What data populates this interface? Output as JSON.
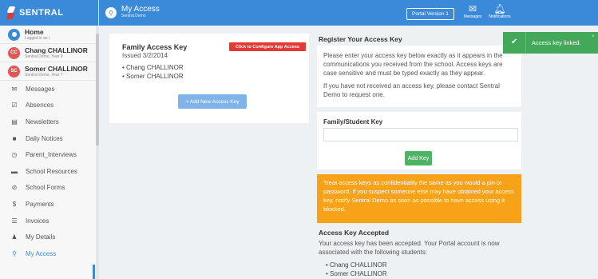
{
  "app": {
    "brand": "SENTRAL",
    "page_title": "My Access",
    "page_subtitle": "Sentral Demo"
  },
  "topbar": {
    "portal_version": "Portal Version 1",
    "messages_label": "Messages",
    "notifications_label": "Notifications"
  },
  "sidebar": {
    "profiles": [
      {
        "name": "Home",
        "sub": "Logged in as i",
        "initials": ""
      },
      {
        "name": "Chang CHALLINOR",
        "sub": "Sentral Demo, Year 9",
        "initials": "CC"
      },
      {
        "name": "Somer CHALLINOR",
        "sub": "Sentral Demo, Year 7",
        "initials": "SC"
      }
    ],
    "items": [
      {
        "label": "Messages",
        "icon": "envelope-icon",
        "glyph": "✉"
      },
      {
        "label": "Absences",
        "icon": "check-icon",
        "glyph": "☑"
      },
      {
        "label": "Newsletters",
        "icon": "newspaper-icon",
        "glyph": "▤"
      },
      {
        "label": "Daily Notices",
        "icon": "notice-icon",
        "glyph": "■"
      },
      {
        "label": "Parent_Interviews",
        "icon": "clock-icon",
        "glyph": "◷"
      },
      {
        "label": "School Resources",
        "icon": "folder-icon",
        "glyph": "▬"
      },
      {
        "label": "School Forms",
        "icon": "forms-icon",
        "glyph": "⊘"
      },
      {
        "label": "Payments",
        "icon": "dollar-icon",
        "glyph": "$"
      },
      {
        "label": "Invoices",
        "icon": "list-icon",
        "glyph": "☰"
      },
      {
        "label": "My Details",
        "icon": "user-icon",
        "glyph": "♟"
      },
      {
        "label": "My Access",
        "icon": "key-icon",
        "glyph": "⚲"
      }
    ]
  },
  "family_key": {
    "title": "Family Access Key",
    "issued": "Issued 3/2/2014",
    "students": [
      "Chang CHALLINOR",
      "Somer CHALLINOR"
    ],
    "configure_button": "Click to Configure App Access",
    "add_button": "+ Add New Access Key"
  },
  "register": {
    "title": "Register Your Access Key",
    "text1": "Please enter your access key below exactly as it appears in the communications you received from the school. Access keys are case sensitive and must be typed exactly as they appear.",
    "text2": "If you have not received an access key, please contact Sentral Demo to request one.",
    "key_label": "Family/Student Key",
    "key_value": "",
    "add_key_button": "Add Key"
  },
  "warning": "Treat access keys as confidentiality the same as you would a pin or password. If you suspect someone else may have obtained your access key, notify Sentral Demo as soon as possible to have access using it blocked.",
  "accepted": {
    "title": "Access Key Accepted",
    "text": "Your access key has been accepted. Your Portal account is now associated with the following students:",
    "students": [
      "Chang CHALLINOR",
      "Somer CHALLINOR"
    ]
  },
  "toast": {
    "message": "Access key linked.",
    "close": "×"
  },
  "colors": {
    "primary": "#3b8ad9",
    "success": "#4cb564",
    "warning": "#f8a21a",
    "danger": "#e53935"
  }
}
